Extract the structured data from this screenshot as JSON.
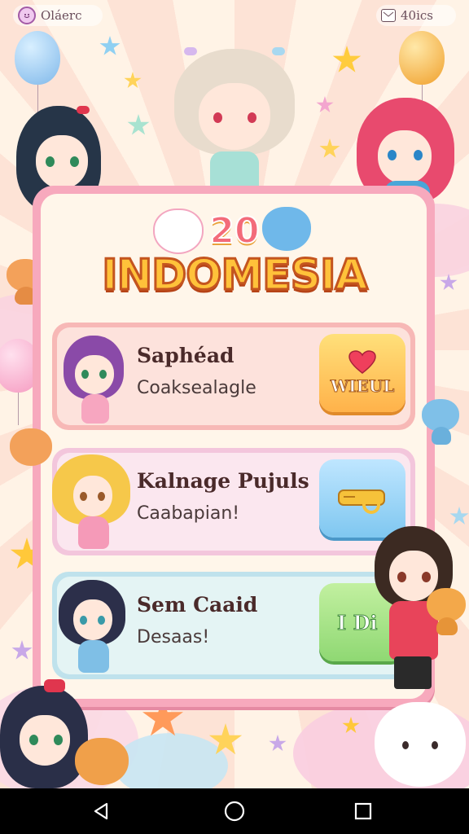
{
  "status_bar": {
    "left_text": "Oláerc",
    "right_text": "40ics"
  },
  "header": {
    "number": "20",
    "title": "INDOMESIA"
  },
  "cards": [
    {
      "name": "Saphéad",
      "subtitle": "Coaksealagle",
      "button_label": "WIEUL",
      "button_icon": "heart-icon"
    },
    {
      "name": "Kalnage Pujuls",
      "subtitle": "Caabapian!",
      "button_label": "",
      "button_icon": "key-icon"
    },
    {
      "name": "Sem Caaid",
      "subtitle": "Desaas!",
      "button_label": "I Di",
      "button_icon": "play-icon"
    }
  ],
  "colors": {
    "accent_pink": "#f7a9bd",
    "title_yellow": "#ffc23a",
    "button_orange": "#ffb24a",
    "button_blue": "#7fc7f0",
    "button_green": "#8fd873"
  },
  "nav_icons": [
    "back-icon",
    "home-icon",
    "recents-icon"
  ]
}
